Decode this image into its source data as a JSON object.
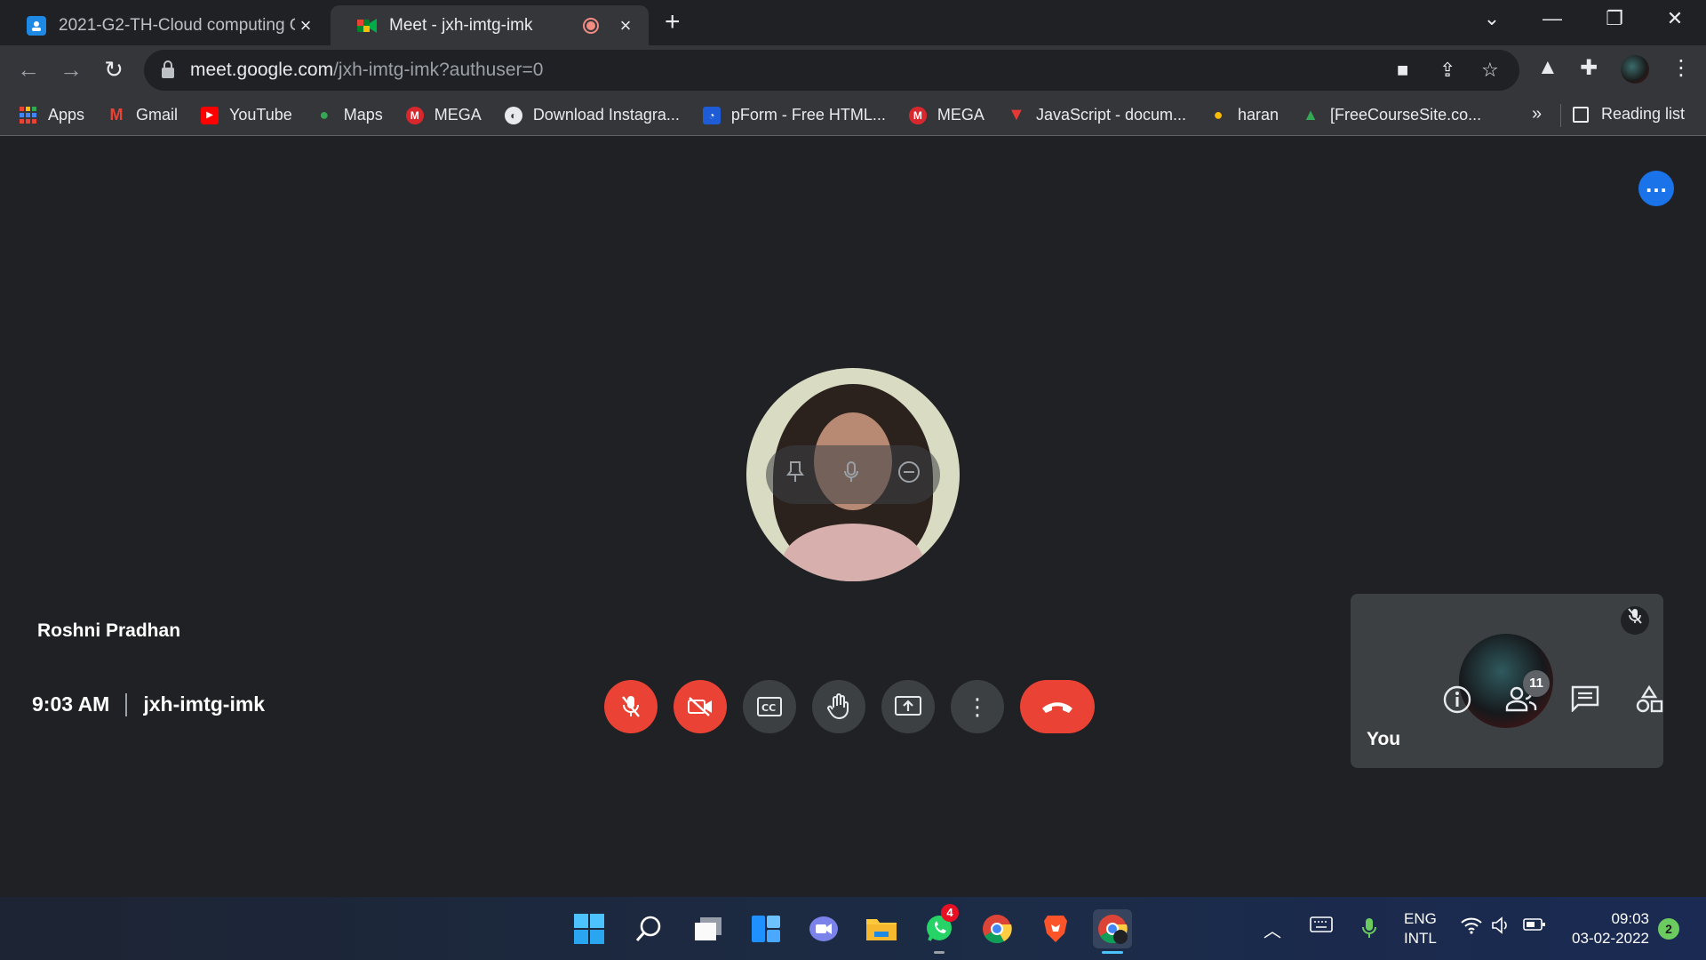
{
  "browser": {
    "tabs": [
      {
        "title": "2021-G2-TH-Cloud computing C",
        "active": false
      },
      {
        "title": "Meet - jxh-imtg-imk",
        "active": true
      }
    ],
    "url_host": "meet.google.com",
    "url_path": "/jxh-imtg-imk?authuser=0",
    "bookmarks": [
      "Apps",
      "Gmail",
      "YouTube",
      "Maps",
      "MEGA",
      "Download Instagra...",
      "pForm - Free HTML...",
      "MEGA",
      "JavaScript - docum...",
      "haran",
      "[FreeCourseSite.co..."
    ],
    "bookmarks_more": "»",
    "reading_list": "Reading list"
  },
  "meet": {
    "speaker_name": "Roshni Pradhan",
    "self_label": "You",
    "time": "9:03 AM",
    "meeting_code": "jxh-imtg-imk",
    "participants_count": "11",
    "colors": {
      "accent": "#1a73e8",
      "danger": "#ea4335",
      "surface": "#3c4043",
      "background": "#202124"
    }
  },
  "taskbar": {
    "whatsapp_badge": "4",
    "lang_line1": "ENG",
    "lang_line2": "INTL",
    "clock_time": "09:03",
    "clock_date": "03-02-2022",
    "notifications": "2"
  }
}
